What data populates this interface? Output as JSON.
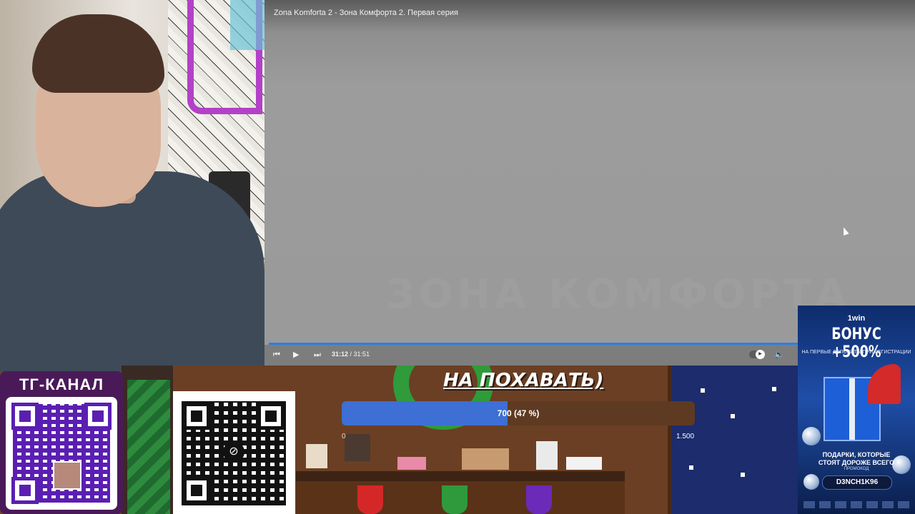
{
  "player": {
    "title": "Zona Komforta 2 - Зона Комфорта 2. Первая серия",
    "background_text": "ЗОНА КОМФОРТА",
    "current_time": "31:12",
    "separator": " / ",
    "duration": "31:51",
    "progress": 0.979,
    "colors": {
      "accent": "#2f7de1"
    }
  },
  "game": {
    "headline": "НА ПОХАВАТЬ)",
    "goal_label": "700 (47 %)",
    "goal_fraction": 0.47,
    "goal_min": "0",
    "goal_max": "1.500"
  },
  "tg": {
    "title": "ТГ-КАНАЛ"
  },
  "ad": {
    "brand": "1win",
    "bonus": "БОНУС +500%",
    "subtitle": "НА ПЕРВЫЕ ДЕПОЗИТЫ ПРИ РЕГИСТРАЦИИ",
    "tagline_1": "ПОДАРКИ, КОТОРЫЕ",
    "tagline_2": "СТОЯТ ДОРОЖЕ ВСЕГО",
    "promo_label": "ПРОМОКОД",
    "promo_code": "D3NCH1K96"
  },
  "icons": {
    "prev": "⏮",
    "play": "▶",
    "next": "⏭",
    "volume": "🔈"
  }
}
